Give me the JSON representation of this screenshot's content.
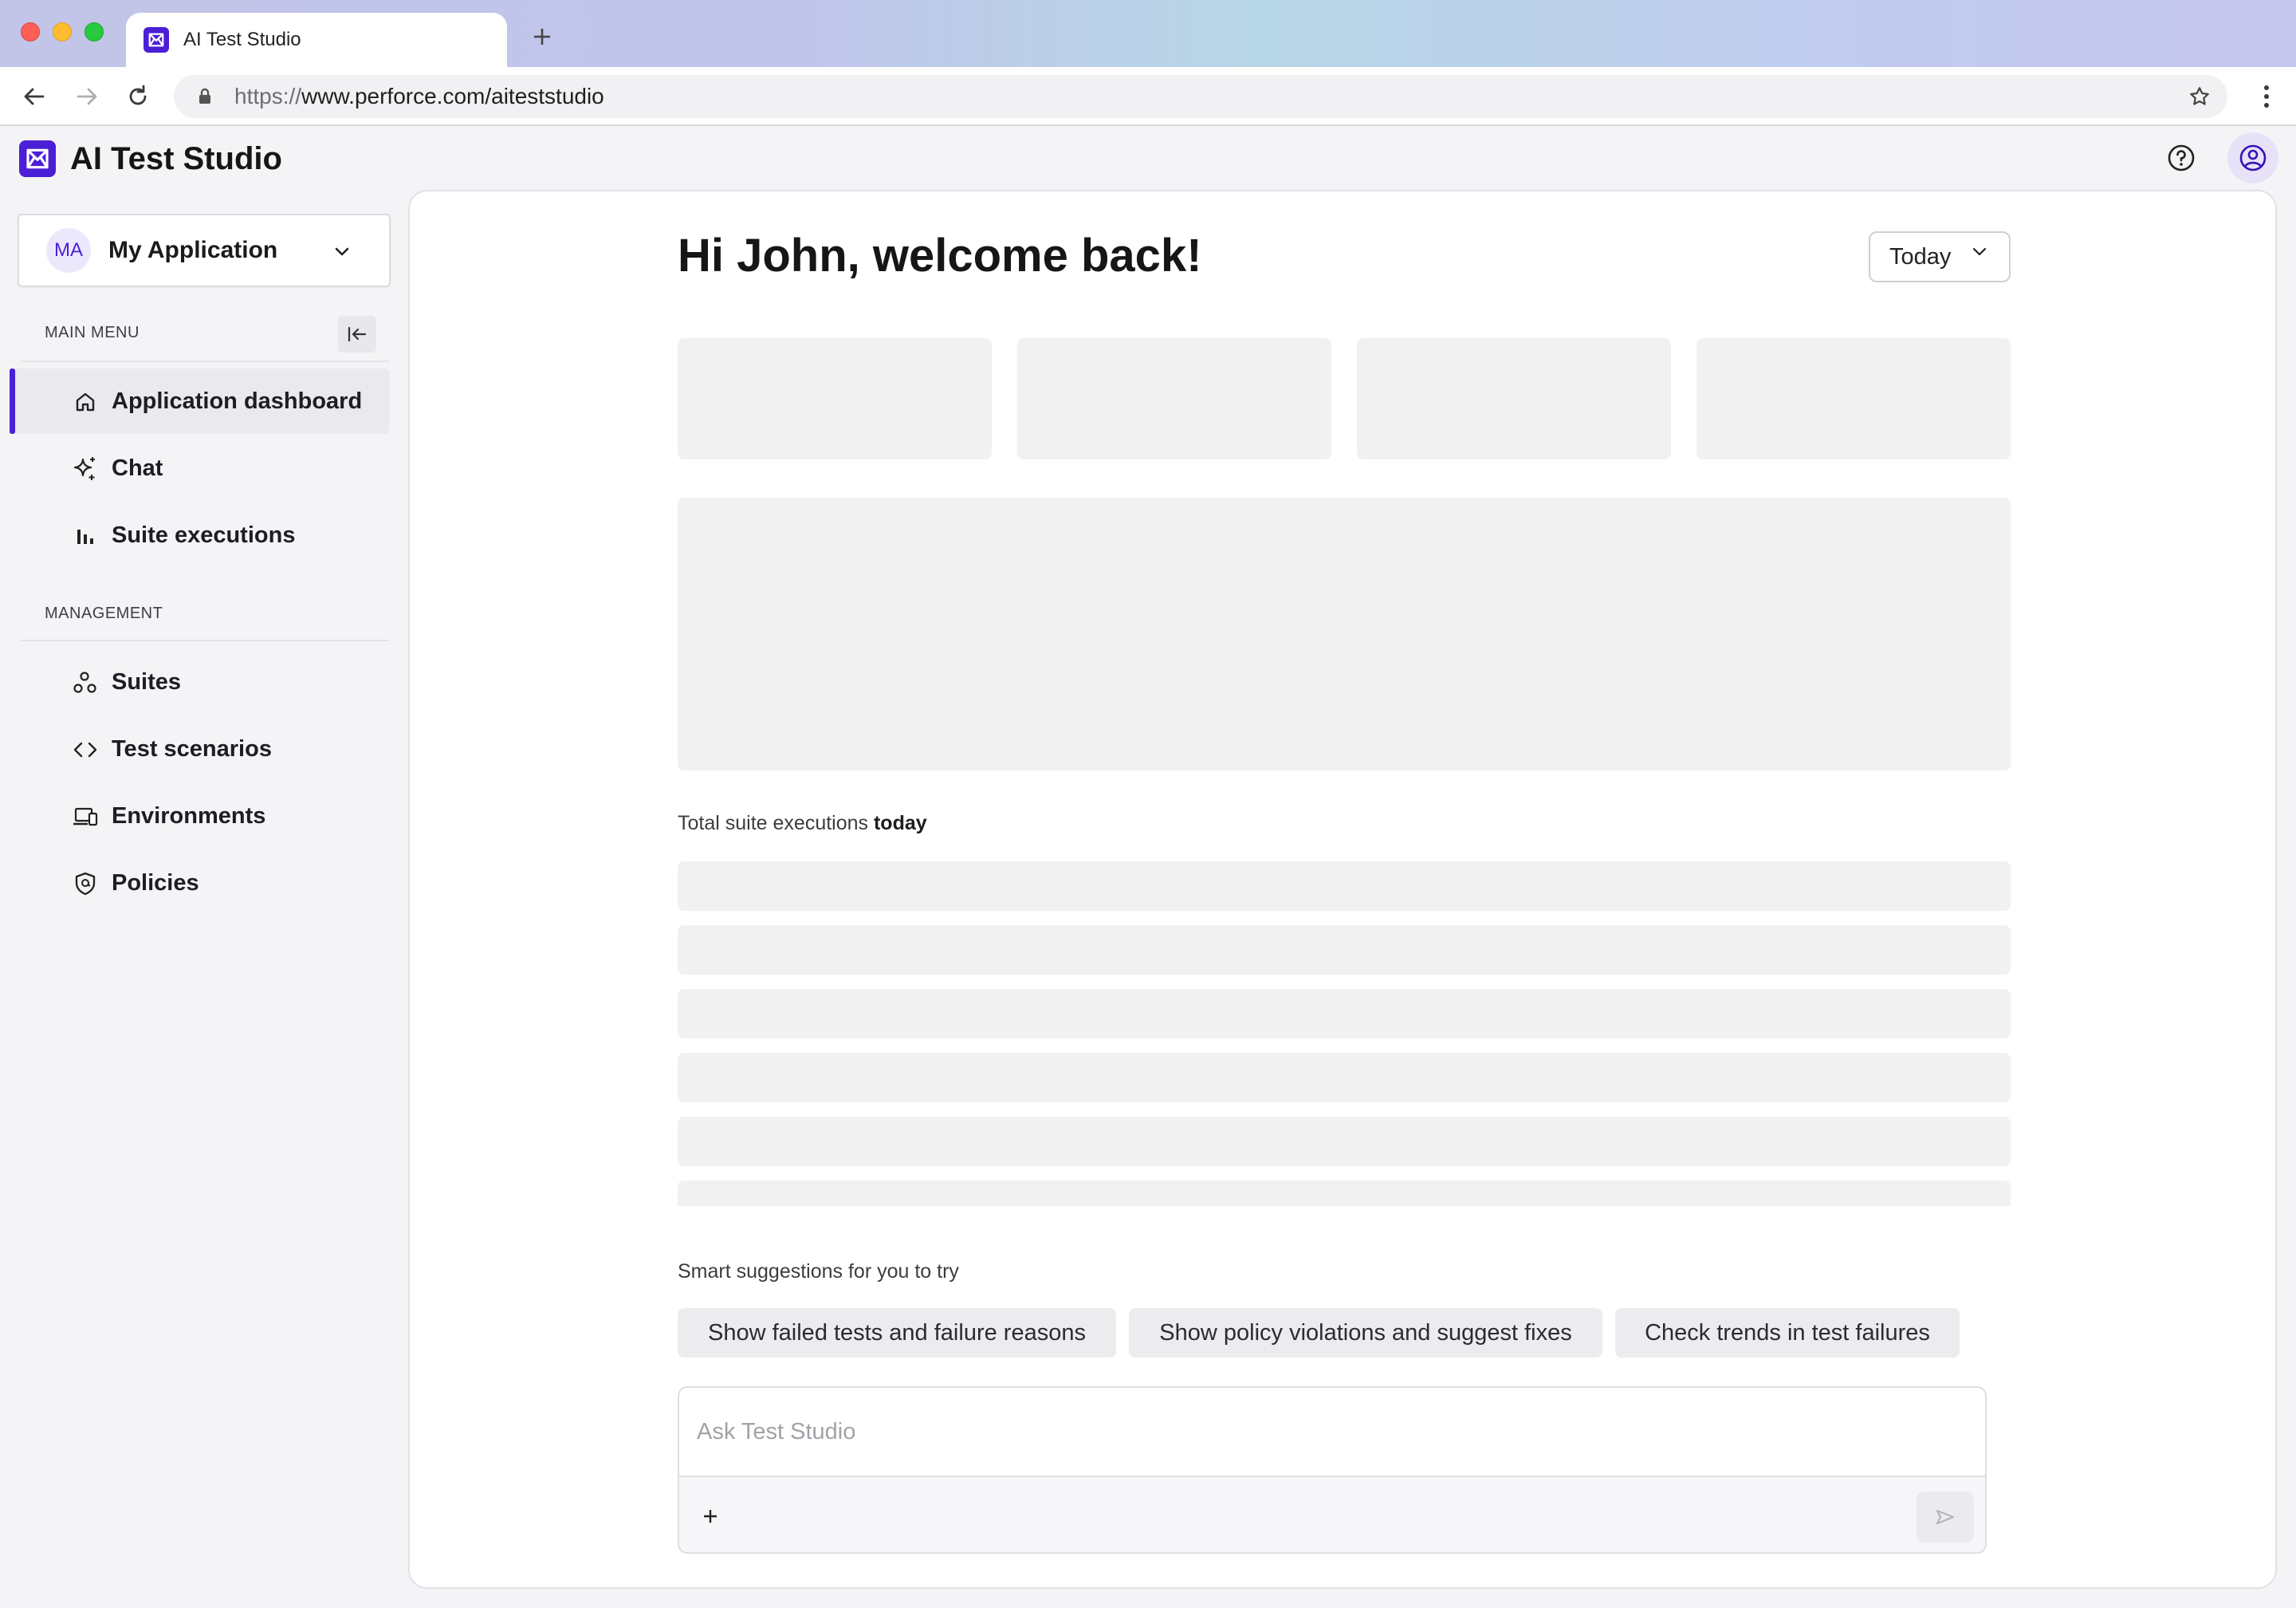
{
  "browser": {
    "tab_title": "AI Test Studio",
    "url_scheme": "https://",
    "url_rest": "www.perforce.com/aiteststudio"
  },
  "app": {
    "title": "AI Test Studio",
    "brand_color": "#4b1fd6"
  },
  "app_switcher": {
    "initials": "MA",
    "name": "My Application"
  },
  "sidebar": {
    "main_menu_label": "MAIN MENU",
    "management_label": "MANAGEMENT",
    "main_items": [
      {
        "label": "Application dashboard",
        "icon": "home-icon",
        "active": true
      },
      {
        "label": "Chat",
        "icon": "sparkle-icon",
        "active": false
      },
      {
        "label": "Suite executions",
        "icon": "bar-chart-icon",
        "active": false
      }
    ],
    "management_items": [
      {
        "label": "Suites",
        "icon": "nodes-icon"
      },
      {
        "label": "Test scenarios",
        "icon": "code-icon"
      },
      {
        "label": "Environments",
        "icon": "devices-icon"
      },
      {
        "label": "Policies",
        "icon": "shield-icon"
      }
    ]
  },
  "main": {
    "greeting": "Hi John, welcome back!",
    "range": "Today",
    "executions_caption_prefix": "Total suite executions",
    "executions_caption_bold": "today",
    "suggestions_caption": "Smart suggestions for you to try",
    "suggestions": [
      "Show failed tests and failure reasons",
      "Show policy violations and suggest fixes",
      "Check trends in test failures"
    ],
    "ask_placeholder": "Ask Test Studio"
  }
}
